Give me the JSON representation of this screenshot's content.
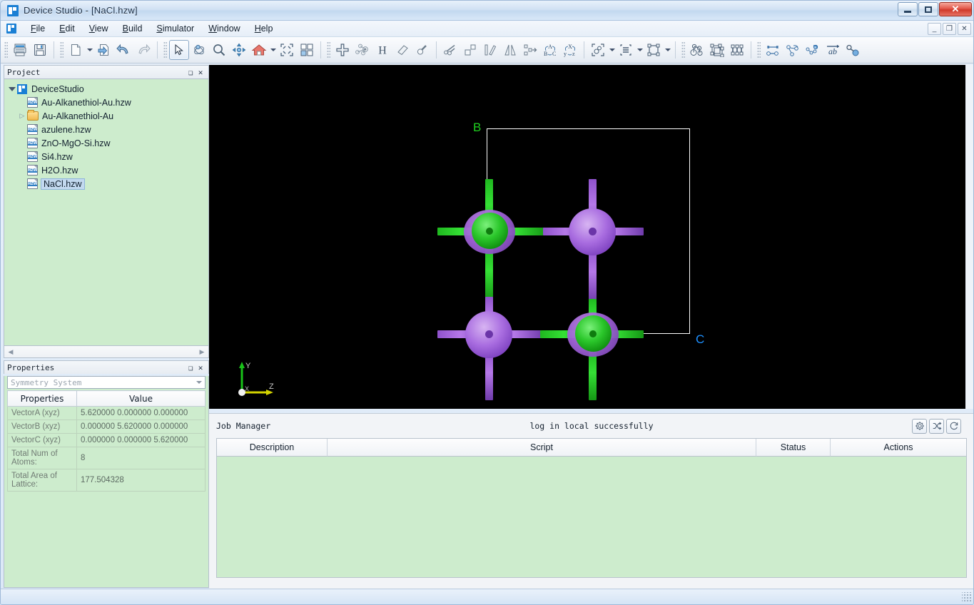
{
  "window": {
    "title": "Device Studio - [NaCl.hzw]",
    "app_icon": "devicestudio-icon",
    "minimize_label": "Minimize",
    "maximize_label": "Maximize",
    "close_label": "✕"
  },
  "mdi": {
    "minimize": "_",
    "restore": "❐",
    "close": "✕"
  },
  "menubar": {
    "items": [
      {
        "accel": "F",
        "rest": "ile"
      },
      {
        "accel": "E",
        "rest": "dit"
      },
      {
        "accel": "V",
        "rest": "iew"
      },
      {
        "accel": "B",
        "rest": "uild"
      },
      {
        "accel": "S",
        "rest": "imulator"
      },
      {
        "accel": "W",
        "rest": "indow"
      },
      {
        "accel": "H",
        "rest": "elp"
      }
    ]
  },
  "toolbar": {
    "groups": [
      {
        "buttons": [
          "print-icon",
          "save-icon"
        ]
      },
      {
        "buttons": [
          "new-document-icon",
          "dropdown",
          "open-document-icon",
          "undo-icon",
          "redo-icon"
        ]
      },
      {
        "buttons": [
          "select-arrow-icon",
          "rotate-icon",
          "zoom-icon",
          "pan-icon",
          "home-view-icon",
          "dropdown",
          "fit-to-view-icon",
          "tile-view-icon"
        ]
      },
      {
        "buttons": [
          "add-atom-icon",
          "add-molecule-icon",
          "add-hydrogen-icon",
          "eraser-icon",
          "measure-icon"
        ]
      },
      {
        "buttons": [
          "cut-bond-icon",
          "transform-icon",
          "ruler-icon",
          "mirror-icon",
          "translate-icon",
          "lattice-abc-icon",
          "axes-xyz-icon"
        ]
      },
      {
        "buttons": [
          "group-select-icon",
          "dropdown",
          "align-icon",
          "dropdown",
          "bounding-box-icon",
          "dropdown"
        ]
      },
      {
        "buttons": [
          "molecule-icon",
          "supercell-icon",
          "device-icon"
        ]
      },
      {
        "buttons": [
          "distance-icon",
          "angle-icon",
          "dihedral-icon",
          "label-ab-icon",
          "bond-icon"
        ]
      }
    ]
  },
  "project_panel": {
    "title": "Project",
    "float_button": "❏",
    "close_button": "✕",
    "tree": [
      {
        "label": "DeviceStudio",
        "icon": "devicestudio-icon",
        "level": 0,
        "expander": "open",
        "selected": false
      },
      {
        "label": "Au-Alkanethiol-Au.hzw",
        "icon": "hzw-file-icon",
        "level": 1,
        "expander": "none",
        "selected": false
      },
      {
        "label": "Au-Alkanethiol-Au",
        "icon": "folder-icon",
        "level": 1,
        "expander": "closed",
        "selected": false
      },
      {
        "label": "azulene.hzw",
        "icon": "hzw-file-icon",
        "level": 1,
        "expander": "none",
        "selected": false
      },
      {
        "label": "ZnO-MgO-Si.hzw",
        "icon": "hzw-file-icon",
        "level": 1,
        "expander": "none",
        "selected": false
      },
      {
        "label": "Si4.hzw",
        "icon": "hzw-file-icon",
        "level": 1,
        "expander": "none",
        "selected": false
      },
      {
        "label": "H2O.hzw",
        "icon": "hzw-file-icon",
        "level": 1,
        "expander": "none",
        "selected": false
      },
      {
        "label": "NaCl.hzw",
        "icon": "hzw-file-icon",
        "level": 1,
        "expander": "none",
        "selected": true
      }
    ],
    "scroll_left": "◀",
    "scroll_right": "▶"
  },
  "properties_panel": {
    "title": "Properties",
    "float_button": "❏",
    "close_button": "✕",
    "selector_value": "Symmetry System",
    "columns": [
      "Properties",
      "Value"
    ],
    "rows": [
      {
        "key": "VectorA (xyz)",
        "value": "5.620000 0.000000 0.000000"
      },
      {
        "key": "VectorB (xyz)",
        "value": "0.000000 5.620000 0.000000"
      },
      {
        "key": "VectorC (xyz)",
        "value": "0.000000 0.000000 5.620000"
      },
      {
        "key": "Total Num of Atoms:",
        "value": "8"
      },
      {
        "key": "Total Area of Lattice:",
        "value": "177.504328"
      }
    ]
  },
  "viewport": {
    "background": "#000000",
    "lattice_label_b": "B",
    "lattice_label_c": "C",
    "lattice_label_b_color": "#1fd01f",
    "lattice_label_c_color": "#1e90ff",
    "axes": {
      "y": "Y",
      "z": "Z",
      "x": "X",
      "y_color": "#19c219",
      "z_color": "#d4d400"
    },
    "structure": {
      "name": "NaCl",
      "atoms": [
        {
          "element": "Cl",
          "color": "#2bc72b",
          "position": "top-left"
        },
        {
          "element": "Na",
          "color": "#a96de0",
          "position": "top-right"
        },
        {
          "element": "Na",
          "color": "#a96de0",
          "position": "bottom-left"
        },
        {
          "element": "Cl",
          "color": "#2bc72b",
          "position": "bottom-right"
        }
      ]
    }
  },
  "job_manager": {
    "title": "Job Manager",
    "status_message": "log in local successfully",
    "buttons": [
      "settings-gear-icon",
      "shuffle-icon",
      "refresh-icon"
    ],
    "columns": [
      "Description",
      "Script",
      "Status",
      "Actions"
    ],
    "rows": []
  },
  "statusbar": {
    "grip": "resize-grip"
  }
}
